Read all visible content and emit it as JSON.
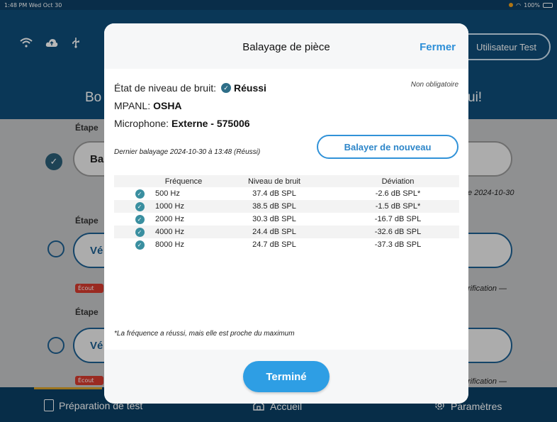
{
  "status_bar": {
    "time": "1:48 PM  Wed Oct 30",
    "battery": "100%"
  },
  "header": {
    "user_button": "Utilisateur Test",
    "greeting_left": "Bo",
    "greeting_right": "ui!"
  },
  "steps": [
    {
      "label": "Étape",
      "button": "Ba",
      "done": true,
      "side_text": "e 2024-10-30"
    },
    {
      "label": "Étape",
      "button": "Vé",
      "done": false,
      "badge": "Écout",
      "side_text": "rification —"
    },
    {
      "label": "Étape",
      "button": "Vé",
      "done": false,
      "badge": "Écout",
      "side_text": "rification —"
    }
  ],
  "footer": {
    "tabs": [
      {
        "label": "Préparation de test",
        "icon": "clipboard-icon"
      },
      {
        "label": "Accueil",
        "icon": "home-icon"
      },
      {
        "label": "Paramètres",
        "icon": "gear-icon"
      }
    ]
  },
  "modal": {
    "title": "Balayage de pièce",
    "close": "Fermer",
    "noise_status_label": "État de niveau de bruit:",
    "noise_status_value": "Réussi",
    "optional": "Non obligatoire",
    "mpanl_label": "MPANL:",
    "mpanl_value": "OSHA",
    "microphone_label": "Microphone:",
    "microphone_value": "Externe - 575006",
    "last_scan": "Dernier balayage 2024-10-30 à 13:48 (Réussi)",
    "rescan_button": "Balayer de nouveau",
    "table": {
      "headers": [
        "Fréquence",
        "Niveau de bruit",
        "Déviation"
      ],
      "rows": [
        {
          "freq": "500 Hz",
          "level": "37.4 dB SPL",
          "dev": "-2.6 dB SPL*"
        },
        {
          "freq": "1000 Hz",
          "level": "38.5 dB SPL",
          "dev": "-1.5 dB SPL*"
        },
        {
          "freq": "2000 Hz",
          "level": "30.3 dB SPL",
          "dev": "-16.7 dB SPL"
        },
        {
          "freq": "4000 Hz",
          "level": "24.4 dB SPL",
          "dev": "-32.6 dB SPL"
        },
        {
          "freq": "8000 Hz",
          "level": "24.7 dB SPL",
          "dev": "-37.3 dB SPL"
        }
      ]
    },
    "note": "*La fréquence a réussi, mais elle est proche du maximum",
    "done_button": "Terminé"
  }
}
